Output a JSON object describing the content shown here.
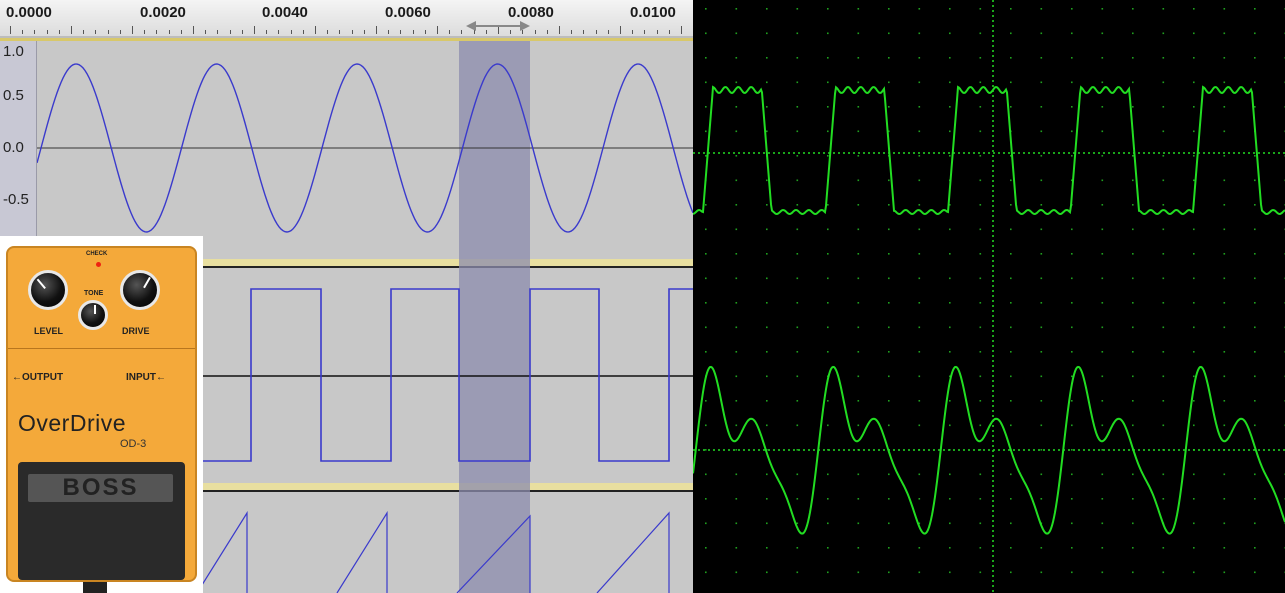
{
  "ruler": {
    "labels": [
      "0.0000",
      "0.0020",
      "0.0040",
      "0.0060",
      "0.0080",
      "0.0100"
    ]
  },
  "yaxis": {
    "labels": [
      "1.0",
      "0.5",
      "0.0",
      "-0.5"
    ]
  },
  "tracks": [
    {
      "waveform": "sine",
      "cycles_visible": 5
    },
    {
      "waveform": "square"
    },
    {
      "waveform": "sawtooth"
    }
  ],
  "selection": {
    "start": 0.0068,
    "end": 0.0078
  },
  "scope": {
    "traces": [
      "clipped-square",
      "distorted-wave"
    ],
    "trace_color": "#22dd22"
  },
  "pedal": {
    "check_label": "CHECK",
    "knob_level": "LEVEL",
    "knob_tone": "TONE",
    "knob_drive": "DRIVE",
    "output_label": "←OUTPUT",
    "input_label": "INPUT←",
    "model_name": "OverDrive",
    "model_code": "OD-3",
    "brand": "BOSS",
    "color": "#f4a93a"
  },
  "colors": {
    "waveform": "#3a3acc",
    "selection": "#9a9ab8",
    "track_bg": "#c8c8c8",
    "scope_bg": "#000000",
    "scope_grid": "#22cc22"
  }
}
